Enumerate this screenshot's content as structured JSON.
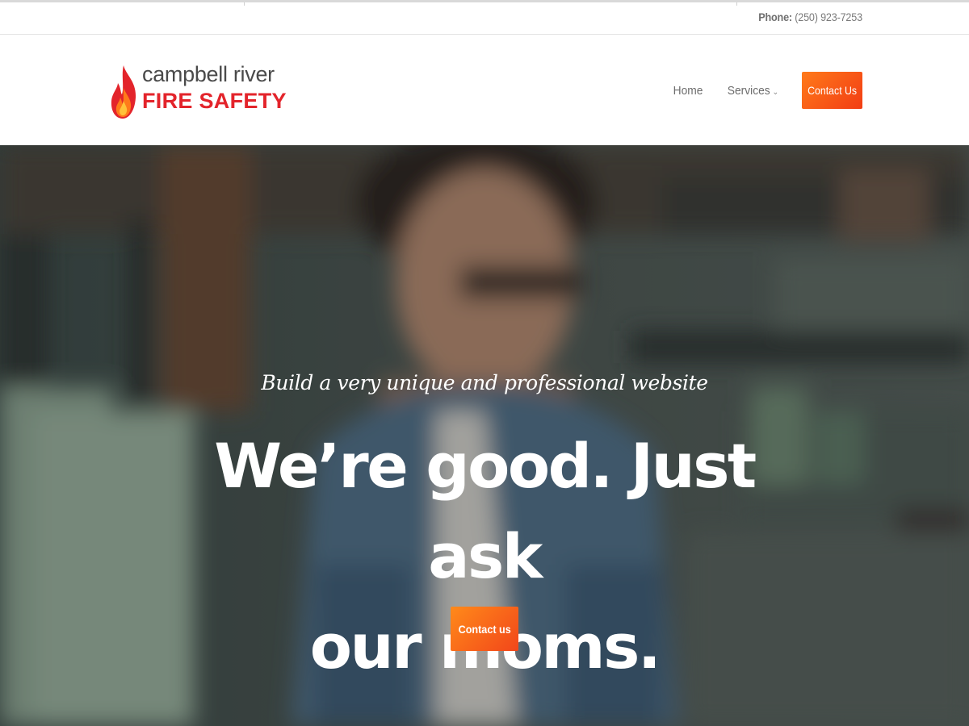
{
  "topbar": {
    "phone_label": "Phone:",
    "phone_number": "(250) 923-7253"
  },
  "logo": {
    "line1": "campbell river",
    "line2": "FIRE SAFETY",
    "icon": "flame-icon",
    "brand_color": "#e3242b"
  },
  "nav": {
    "items": [
      {
        "label": "Home"
      },
      {
        "label": "Services",
        "has_dropdown": true
      }
    ],
    "cta_label": "Contact Us"
  },
  "hero": {
    "tagline": "Build a very unique and professional website",
    "headline_line1": "We’re good. Just ask",
    "headline_line2": "our moms.",
    "cta_label": "Contact us"
  },
  "colors": {
    "accent_start": "#ff7a1a",
    "accent_end": "#f23d14",
    "text_gray": "#6c6c6c"
  }
}
